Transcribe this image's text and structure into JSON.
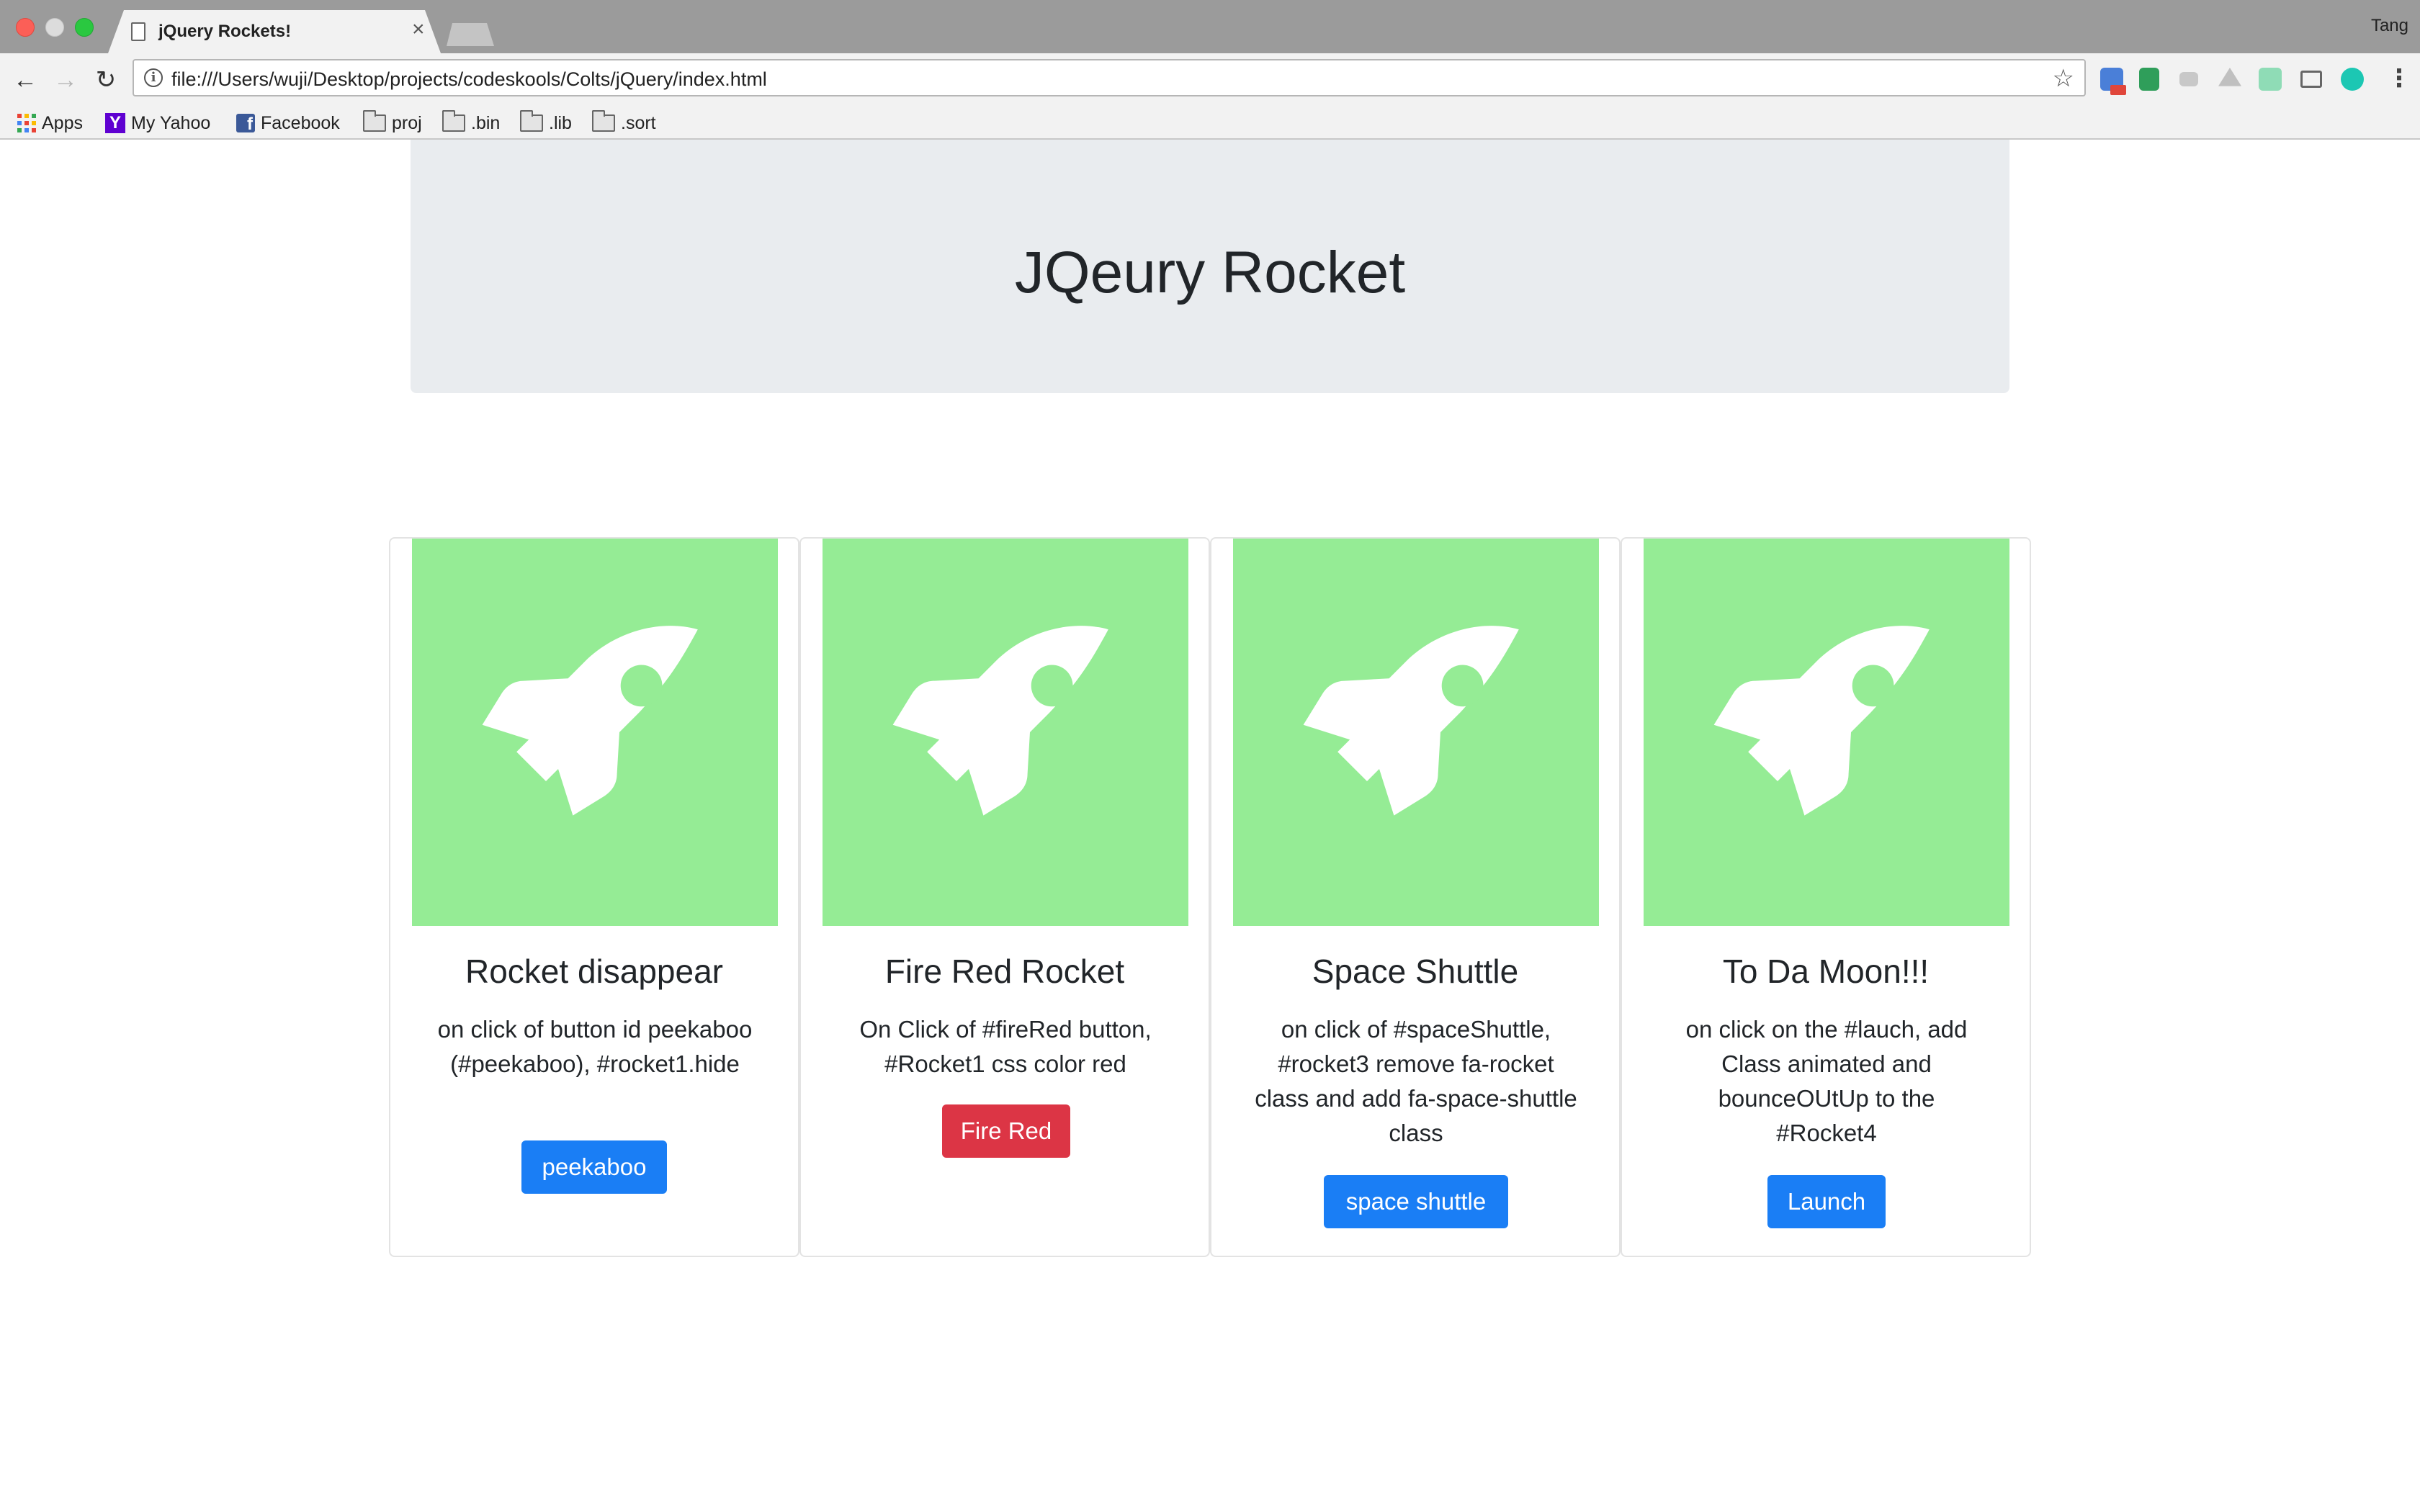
{
  "browser": {
    "tab_title": "jQuery Rockets!",
    "tab_close": "×",
    "profile_name": "Tang",
    "url": "file:///Users/wuji/Desktop/projects/codeskools/Colts/jQuery/index.html",
    "back_icon": "←",
    "forward_icon": "→",
    "reload_icon": "↻",
    "star_icon": "☆",
    "menu_icon": "⋮",
    "info_icon": "i",
    "bookmarks": [
      {
        "label": "Apps",
        "icon": "apps-grid-icon"
      },
      {
        "label": "My Yahoo",
        "icon": "yahoo-icon"
      },
      {
        "label": "Facebook",
        "icon": "facebook-icon"
      },
      {
        "label": "proj",
        "icon": "folder-icon"
      },
      {
        "label": ".bin",
        "icon": "folder-icon"
      },
      {
        "label": ".lib",
        "icon": "folder-icon"
      },
      {
        "label": ".sort",
        "icon": "folder-icon"
      }
    ],
    "yahoo_letter": "Y",
    "facebook_letter": "f"
  },
  "jumbotron": {
    "title": "JQeury Rocket"
  },
  "cards": [
    {
      "title": "Rocket disappear",
      "text": "on click of button id peekaboo (#peekaboo), #rocket1.hide",
      "button": "peekaboo",
      "button_style": "primary"
    },
    {
      "title": "Fire Red Rocket",
      "text": "On Click of #fireRed button, #Rocket1 css color red",
      "button": "Fire Red",
      "button_style": "danger"
    },
    {
      "title": "Space Shuttle",
      "text": "on click of #spaceShuttle, #rocket3 remove fa-rocket class and add fa-space-shuttle class",
      "button": "space shuttle",
      "button_style": "primary"
    },
    {
      "title": "To Da Moon!!!",
      "text": "on click on the #lauch, add Class animated and bounceOUtUp to the #Rocket4",
      "button": "Launch",
      "button_style": "primary"
    }
  ],
  "colors": {
    "card_image_bg": "#95ec95",
    "primary": "#1a7ef5",
    "danger": "#dc3545",
    "jumbotron_bg": "#e9ecef"
  }
}
